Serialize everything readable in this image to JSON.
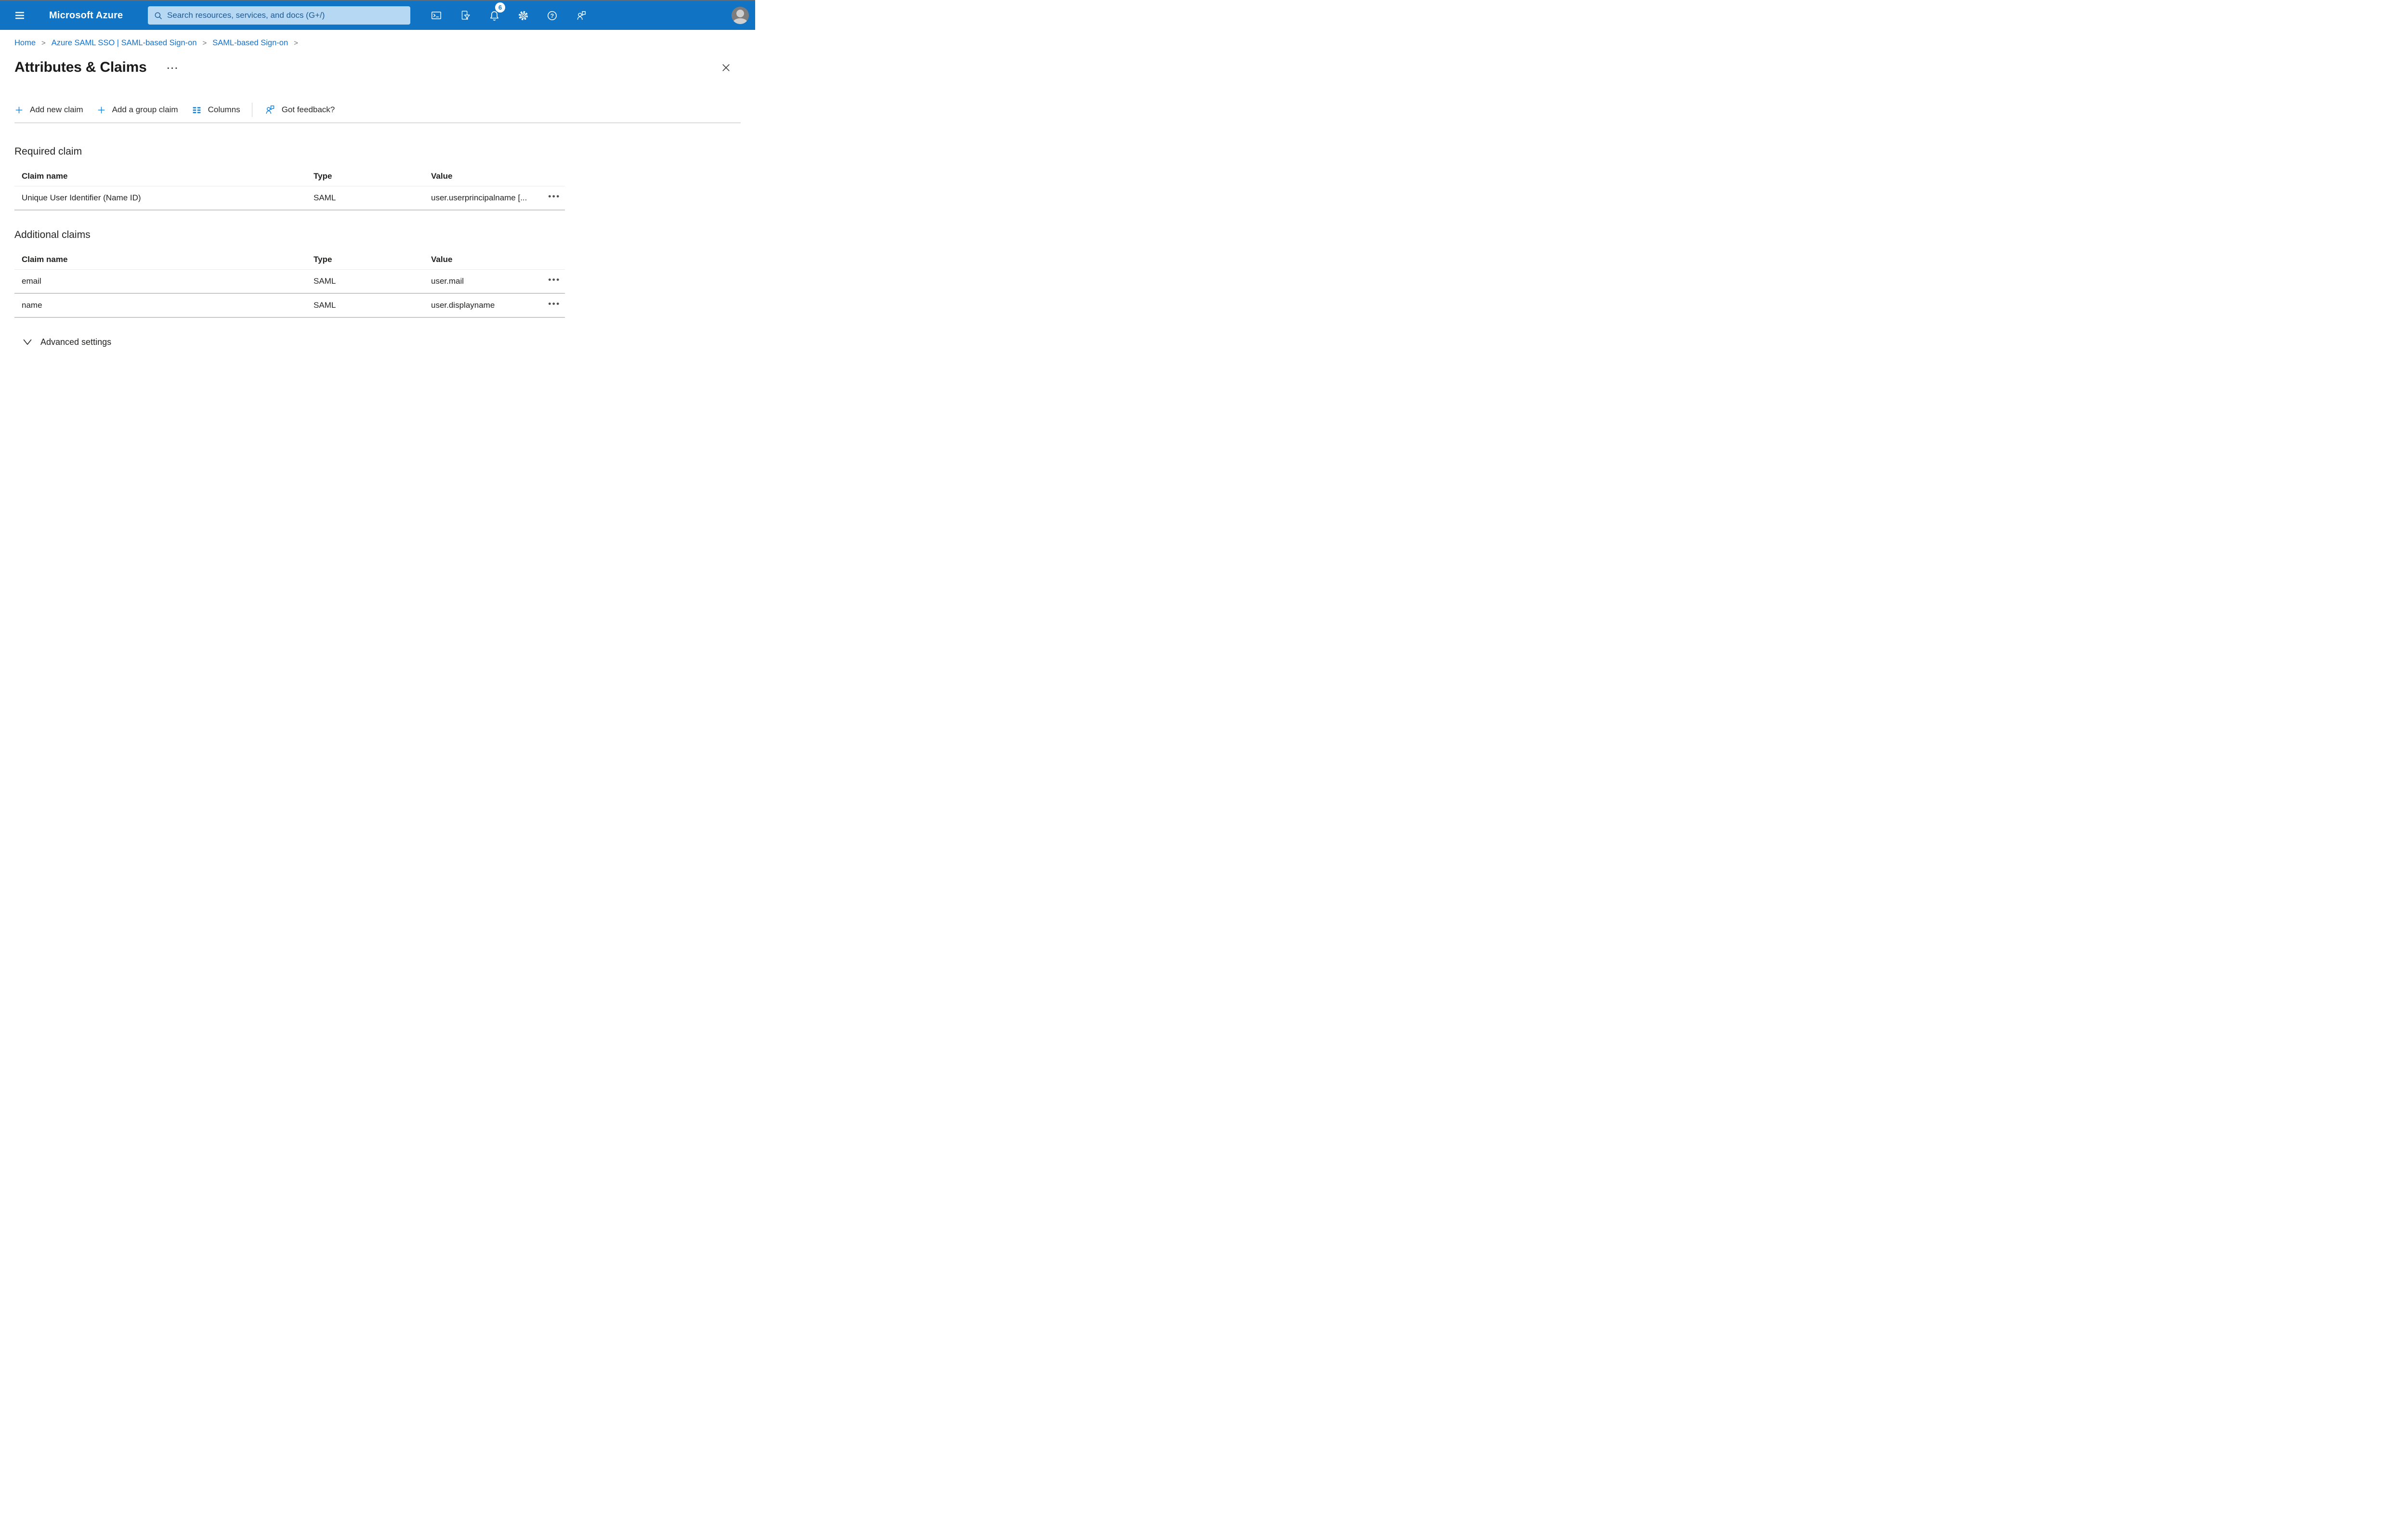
{
  "colors": {
    "topbar_bg": "#1173c4",
    "search_bg": "#b6d8f2",
    "search_text": "#1d5a96",
    "link_blue": "#0e72d1",
    "accent_blue": "#1b83d9",
    "text_dark": "#201f1e"
  },
  "topbar": {
    "product": "Microsoft Azure",
    "search": {
      "placeholder": "Search resources, services, and docs (G+/)"
    },
    "notifications_badge": "6",
    "icons": {
      "hamburger": "hamburger-menu-icon",
      "cloud_shell": "cloud-shell-terminal-icon",
      "directory_filter": "directory-filter-icon",
      "notifications": "notifications-bell-icon",
      "settings": "settings-gear-icon",
      "help": "help-icon",
      "feedback": "person-feedback-icon",
      "avatar": "user-avatar"
    }
  },
  "breadcrumb": {
    "separator": ">",
    "items": [
      {
        "label": "Home"
      },
      {
        "label": "Azure SAML SSO | SAML-based Sign-on"
      },
      {
        "label": "SAML-based Sign-on"
      }
    ]
  },
  "page": {
    "title": "Attributes & Claims",
    "more_options_glyph": "···"
  },
  "toolbar": {
    "items": [
      {
        "icon": "plus-icon",
        "label": "Add new claim"
      },
      {
        "icon": "plus-icon",
        "label": "Add a group claim"
      },
      {
        "icon": "columns-icon",
        "label": "Columns"
      },
      {
        "icon": "person-feedback-icon",
        "label": "Got feedback?"
      }
    ]
  },
  "required_claim": {
    "heading": "Required claim",
    "columns": [
      "Claim name",
      "Type",
      "Value"
    ],
    "rows": [
      {
        "claim_name": "Unique User Identifier (Name ID)",
        "type": "SAML",
        "value": "user.userprincipalname [..."
      }
    ]
  },
  "additional_claims": {
    "heading": "Additional claims",
    "columns": [
      "Claim name",
      "Type",
      "Value"
    ],
    "rows": [
      {
        "claim_name": "email",
        "type": "SAML",
        "value": "user.mail"
      },
      {
        "claim_name": "name",
        "type": "SAML",
        "value": "user.displayname"
      }
    ]
  },
  "row_menu_glyph": "•••",
  "advanced_settings": {
    "label": "Advanced settings"
  }
}
